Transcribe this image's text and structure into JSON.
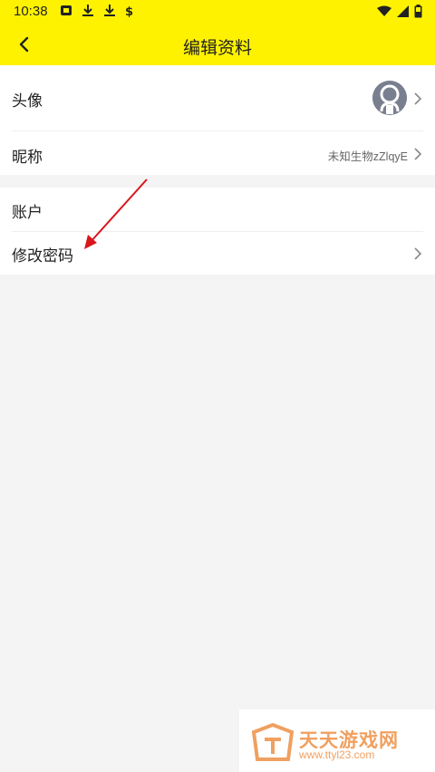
{
  "status_bar": {
    "time": "10:38",
    "left_icons": [
      "notification-icon",
      "download-icon",
      "download-icon",
      "app-icon"
    ],
    "right_icons": [
      "wifi-icon",
      "signal-icon",
      "battery-icon"
    ]
  },
  "header": {
    "title": "编辑资料",
    "back_icon": "chevron-left-icon",
    "background": "#fff200"
  },
  "profile_section": {
    "avatar_label": "头像",
    "nickname_label": "昵称",
    "nickname_value": "未知生物zZlqyE"
  },
  "account_section": {
    "account_label": "账户",
    "change_password_label": "修改密码"
  },
  "annotation": {
    "arrow_color": "#d9161c"
  },
  "watermark": {
    "name": "天天游戏网",
    "url": "www.ttyl23.com",
    "color": "#f0a060"
  }
}
